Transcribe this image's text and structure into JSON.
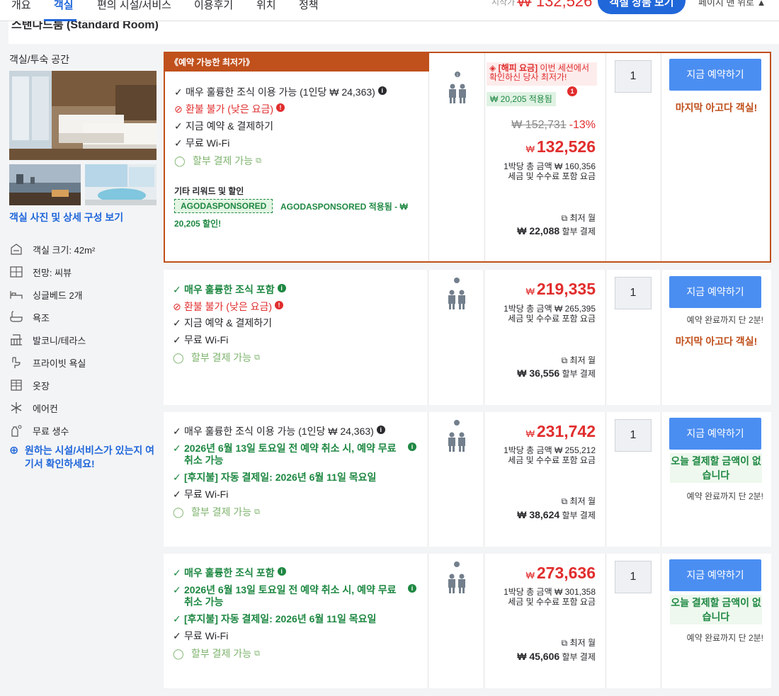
{
  "nav": {
    "tabs": [
      "개요",
      "객실",
      "편의 시설/서비스",
      "이용후기",
      "위치",
      "정책"
    ],
    "price_prefix": "시작가",
    "price_value": "₩ 132,526",
    "cta": "객실 상품 보기",
    "back_to_top": "페이지 맨 위로"
  },
  "room": {
    "title": "스탠다드룸 (Standard Room)",
    "section_title": "객실/투숙 공간",
    "photo_link": "객실 사진 및 상세 구성 보기",
    "features": [
      {
        "icon": "room-size-icon",
        "label": "객실 크기: 42m²"
      },
      {
        "icon": "view-icon",
        "label": "전망: 씨뷰"
      },
      {
        "icon": "bed-icon",
        "label": "싱글베드 2개"
      },
      {
        "icon": "bathtub-icon",
        "label": "욕조"
      },
      {
        "icon": "balcony-icon",
        "label": "발코니/테라스"
      },
      {
        "icon": "private-bath-icon",
        "label": "프라이빗 욕실"
      },
      {
        "icon": "closet-icon",
        "label": "옷장"
      },
      {
        "icon": "snowflake-icon",
        "label": "에어컨"
      },
      {
        "icon": "water-bottle-icon",
        "label": "무료 생수"
      }
    ],
    "facility_link": "원하는 시설/서비스가 있는지 여기서 확인하세요!"
  },
  "offers": [
    {
      "tag": "《예약 가능한 최저가》",
      "lines": [
        {
          "type": "check",
          "text": "매우 훌륭한 조식 이용 가능 (1인당 ₩ 24,363)",
          "info": "dark"
        },
        {
          "type": "refund",
          "text": "환불 불가 (낮은 요금)",
          "info": "red"
        },
        {
          "type": "check",
          "text": "지금 예약 & 결제하기"
        },
        {
          "type": "check",
          "text": "무료 Wi-Fi"
        },
        {
          "type": "installment",
          "text": "할부 결제 가능"
        }
      ],
      "sponsor_label": "기타 리워드 및 할인",
      "sponsor_code": "AGODASPONSORED",
      "sponsor_text": "AGODASPONSORED 적용됨 -",
      "sponsor_text2": "20,205 할인!",
      "sponsor_currency": "₩",
      "sale_badge": "[해피 요금]",
      "sale_text": "이번 세션에서 확인하신 당사 최저가!",
      "applied": "₩ 20,205 적용됨",
      "applied_badge": "1",
      "original_price": "₩ 152,731",
      "discount": "-13%",
      "currency": "₩",
      "price": "132,526",
      "total": "1박당 총 금액 ₩ 160,356",
      "tax_note": "세금 및 수수료 포함 요금",
      "monthly_label": "최저 월",
      "monthly_amount": "₩ 22,088",
      "monthly_suffix": "할부 결제",
      "qty": "1",
      "book": "지금 예약하기",
      "urgency": "마지막 아고다 객실!",
      "note": ""
    },
    {
      "lines": [
        {
          "type": "check-green",
          "text": "매우 훌륭한 조식 포함",
          "info": "green"
        },
        {
          "type": "refund",
          "text": "환불 불가 (낮은 요금)",
          "info": "red"
        },
        {
          "type": "check",
          "text": "지금 예약 & 결제하기"
        },
        {
          "type": "check",
          "text": "무료 Wi-Fi"
        },
        {
          "type": "installment",
          "text": "할부 결제 가능"
        }
      ],
      "currency": "₩",
      "price": "219,335",
      "total": "1박당 총 금액 ₩ 265,395",
      "tax_note": "세금 및 수수료 포함 요금",
      "monthly_label": "최저 월",
      "monthly_amount": "₩ 36,556",
      "monthly_suffix": "할부 결제",
      "qty": "1",
      "book": "지금 예약하기",
      "note": "예약 완료까지 단 2분!",
      "urgency": "마지막 아고다 객실!"
    },
    {
      "lines": [
        {
          "type": "check",
          "text": "매우 훌륭한 조식 이용 가능 (1인당 ₩ 24,363)",
          "info": "dark"
        },
        {
          "type": "check-green",
          "text": "2026년 6월 13일 토요일 전 예약 취소 시, 예약 무료 취소 가능",
          "info": "green"
        },
        {
          "type": "check-green",
          "text": "[후지불] 자동 결제일: 2026년 6월 11일 목요일"
        },
        {
          "type": "check",
          "text": "무료 Wi-Fi"
        },
        {
          "type": "installment",
          "text": "할부 결제 가능"
        }
      ],
      "currency": "₩",
      "price": "231,742",
      "total": "1박당 총 금액 ₩ 255,212",
      "tax_note": "세금 및 수수료 포함 요금",
      "monthly_label": "최저 월",
      "monthly_amount": "₩ 38,624",
      "monthly_suffix": "할부 결제",
      "qty": "1",
      "book": "지금 예약하기",
      "pay_today": "오늘 결제할 금액이 없습니다",
      "note": "예약 완료까지 단 2분!"
    },
    {
      "lines": [
        {
          "type": "check-green",
          "text": "매우 훌륭한 조식 포함",
          "info": "green"
        },
        {
          "type": "check-green",
          "text": "2026년 6월 13일 토요일 전 예약 취소 시, 예약 무료 취소 가능",
          "info": "green"
        },
        {
          "type": "check-green",
          "text": "[후지불] 자동 결제일: 2026년 6월 11일 목요일"
        },
        {
          "type": "check",
          "text": "무료 Wi-Fi"
        },
        {
          "type": "installment",
          "text": "할부 결제 가능"
        }
      ],
      "currency": "₩",
      "price": "273,636",
      "total": "1박당 총 금액 ₩ 301,358",
      "tax_note": "세금 및 수수료 포함 요금",
      "monthly_label": "최저 월",
      "monthly_amount": "₩ 45,606",
      "monthly_suffix": "할부 결제",
      "qty": "1",
      "book": "지금 예약하기",
      "pay_today": "오늘 결제할 금액이 없습니다",
      "note": "예약 완료까지 단 2분!"
    }
  ],
  "colors": {
    "brand_blue": "#2067da",
    "book_button": "#4b8ef1",
    "price_red": "#e12d2d",
    "highlight_orange": "#c0501c",
    "green": "#1e8842"
  }
}
